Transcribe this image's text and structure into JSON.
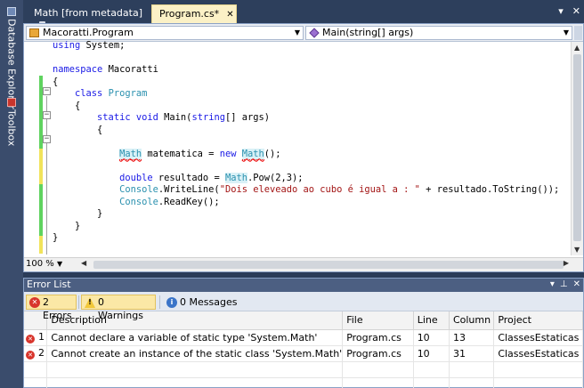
{
  "side_panels": [
    "Database Explorer",
    "Toolbox"
  ],
  "doc_tabs": [
    {
      "label": "Math [from metadata]",
      "locked": true
    },
    {
      "label": "Program.cs*",
      "active": true
    }
  ],
  "navbar": {
    "type_combo": "Macoratti.Program",
    "member_combo": "Main(string[] args)"
  },
  "code_lines": [
    "using System;",
    "",
    "namespace Macoratti",
    "{",
    "    class Program",
    "    {",
    "        static void Main(string[] args)",
    "        {",
    "",
    "            Math matematica = new Math();",
    "",
    "            double resultado = Math.Pow(2,3);",
    "            Console.WriteLine(\"Dois eleveado ao cubo é igual a : \" + resultado.ToString());",
    "            Console.ReadKey();",
    "        }",
    "    }",
    "}"
  ],
  "zoom": "100 %",
  "error_list": {
    "title": "Error List",
    "filters": {
      "errors": "2 Errors",
      "warnings": "0 Warnings",
      "messages": "0 Messages"
    },
    "columns": [
      "",
      "Description",
      "File",
      "Line",
      "Column",
      "Project"
    ],
    "rows": [
      {
        "num": "1",
        "description": "Cannot declare a variable of static type 'System.Math'",
        "file": "Program.cs",
        "line": "10",
        "column": "13",
        "project": "ClassesEstaticas"
      },
      {
        "num": "2",
        "description": "Cannot create an instance of the static class 'System.Math'",
        "file": "Program.cs",
        "line": "10",
        "column": "31",
        "project": "ClassesEstaticas"
      }
    ]
  },
  "colors": {
    "ide_bg": "#2b3c59",
    "active_tab": "#fbf1c6",
    "keyword": "#1a1ae6",
    "type": "#2b91af",
    "string": "#a31515",
    "error": "#d8352c"
  }
}
